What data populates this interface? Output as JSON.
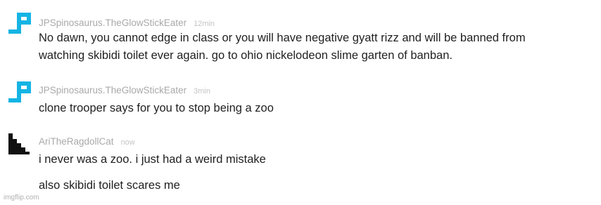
{
  "messages": [
    {
      "username": "JPSpinosaurus.TheGlowStickEater",
      "time": "12min",
      "avatar_icon": "blue-pixel-avatar-icon",
      "avatar_color": "#14b4e4",
      "lines": [
        "No dawn, you cannot edge in class or you will have negative gyatt rizz and will be banned from",
        "watching skibidi toilet ever again. go to ohio nickelodeon slime garten of banban."
      ]
    },
    {
      "username": "JPSpinosaurus.TheGlowStickEater",
      "time": "3min",
      "avatar_icon": "blue-pixel-avatar-icon",
      "avatar_color": "#14b4e4",
      "lines": [
        "clone trooper says for you to stop being a zoo"
      ]
    },
    {
      "username": "AriTheRagdollCat",
      "time": "now",
      "avatar_icon": "black-staircase-avatar-icon",
      "avatar_color": "#111111",
      "lines": [
        "i never was a zoo. i just had a weird mistake",
        "also skibidi toilet scares me"
      ]
    }
  ],
  "watermark": "imgflip.com"
}
